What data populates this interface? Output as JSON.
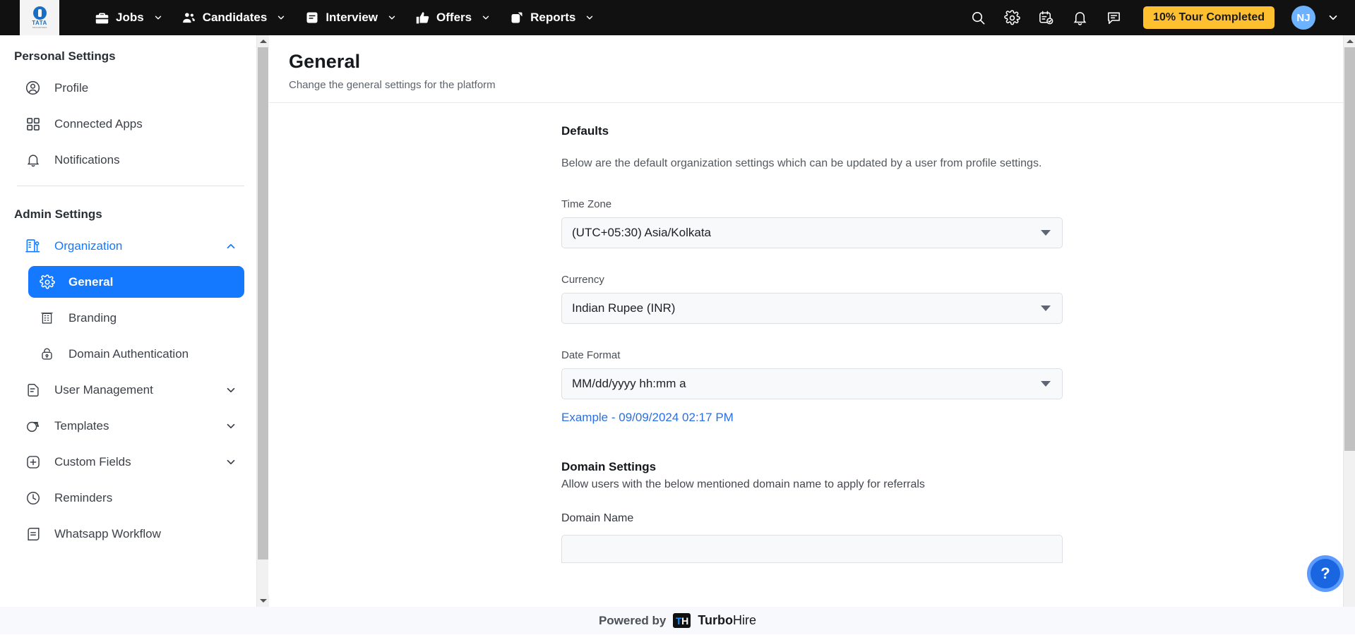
{
  "topnav": {
    "logo_main": "TATA",
    "logo_sub": "TATA MOTORS",
    "items": [
      {
        "label": "Jobs",
        "icon": "briefcase-icon",
        "chevron": true
      },
      {
        "label": "Candidates",
        "icon": "people-icon",
        "chevron": true
      },
      {
        "label": "Interview",
        "icon": "document-icon",
        "chevron": true
      },
      {
        "label": "Offers",
        "icon": "thumbs-up-icon",
        "chevron": true
      },
      {
        "label": "Reports",
        "icon": "reports-icon",
        "chevron": true
      }
    ],
    "icons": [
      "search-icon",
      "gear-icon",
      "calendar-check-icon",
      "bell-icon",
      "chat-icon"
    ],
    "tour_badge": "10% Tour Completed",
    "avatar_initials": "NJ",
    "badge_color": "#fec02f",
    "avatar_color": "#6cb2ff"
  },
  "sidebar": {
    "personal_title": "Personal Settings",
    "personal_items": [
      {
        "label": "Profile",
        "icon": "user-circle-icon"
      },
      {
        "label": "Connected Apps",
        "icon": "grid-icon"
      },
      {
        "label": "Notifications",
        "icon": "bell-icon"
      }
    ],
    "admin_title": "Admin Settings",
    "admin_items": [
      {
        "label": "Organization",
        "icon": "building-icon",
        "expanded": true,
        "chevron": "up",
        "accent": "#1479ff"
      },
      {
        "label": "General",
        "icon": "gear-icon",
        "child": true,
        "active": true
      },
      {
        "label": "Branding",
        "icon": "branding-icon",
        "child": true,
        "active": false
      },
      {
        "label": "Domain Authentication",
        "icon": "lock-icon",
        "child": true,
        "active": false
      },
      {
        "label": "User Management",
        "icon": "user-doc-icon",
        "chevron": "down"
      },
      {
        "label": "Templates",
        "icon": "templates-icon",
        "chevron": "down"
      },
      {
        "label": "Custom Fields",
        "icon": "plus-square-icon",
        "chevron": "down"
      },
      {
        "label": "Reminders",
        "icon": "clock-icon"
      },
      {
        "label": "Whatsapp Workflow",
        "icon": "workflow-icon"
      }
    ]
  },
  "main": {
    "title": "General",
    "subtitle": "Change the general settings for the platform",
    "defaults": {
      "heading": "Defaults",
      "description": "Below are the default organization settings which can be updated by a user from profile settings.",
      "timezone_label": "Time Zone",
      "timezone_value": "(UTC+05:30) Asia/Kolkata",
      "currency_label": "Currency",
      "currency_value": "Indian Rupee (INR)",
      "dateformat_label": "Date Format",
      "dateformat_value": "MM/dd/yyyy hh:mm a",
      "example": "Example - 09/09/2024 02:17 PM",
      "example_color": "#2c6fe3"
    },
    "domain": {
      "heading": "Domain Settings",
      "description": "Allow users with the below mentioned domain name to apply for referrals",
      "name_label": "Domain Name",
      "name_value": ""
    }
  },
  "footer": {
    "powered_by": "Powered by",
    "badge_t": "T",
    "badge_h": "H",
    "brand_bold": "Turbo",
    "brand_rest": "Hire"
  },
  "help": {
    "label": "?"
  }
}
